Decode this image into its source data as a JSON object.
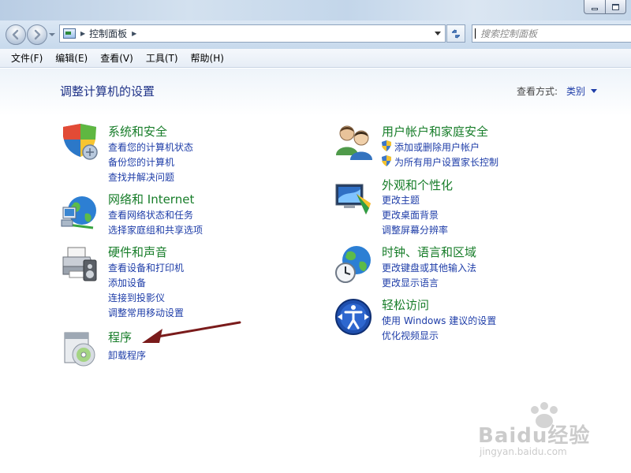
{
  "window": {
    "address": {
      "crumb": "控制面板"
    },
    "search": {
      "placeholder": "搜索控制面板"
    }
  },
  "menu": [
    "文件(F)",
    "编辑(E)",
    "查看(V)",
    "工具(T)",
    "帮助(H)"
  ],
  "page": {
    "title": "调整计算机的设置",
    "view_by_label": "查看方式:",
    "view_by_value": "类别"
  },
  "categories": {
    "system": {
      "title": "系统和安全",
      "links": [
        "查看您的计算机状态",
        "备份您的计算机",
        "查找并解决问题"
      ]
    },
    "network": {
      "title": "网络和 Internet",
      "links": [
        "查看网络状态和任务",
        "选择家庭组和共享选项"
      ]
    },
    "hardware": {
      "title": "硬件和声音",
      "links": [
        "查看设备和打印机",
        "添加设备",
        "连接到投影仪",
        "调整常用移动设置"
      ]
    },
    "programs": {
      "title": "程序",
      "links": [
        "卸载程序"
      ]
    },
    "users": {
      "title": "用户帐户和家庭安全",
      "links": [
        "添加或删除用户帐户",
        "为所有用户设置家长控制"
      ]
    },
    "appearance": {
      "title": "外观和个性化",
      "links": [
        "更改主题",
        "更改桌面背景",
        "调整屏幕分辨率"
      ]
    },
    "clock": {
      "title": "时钟、语言和区域",
      "links": [
        "更改键盘或其他输入法",
        "更改显示语言"
      ]
    },
    "access": {
      "title": "轻松访问",
      "links": [
        "使用 Windows 建议的设置",
        "优化视频显示"
      ]
    }
  },
  "watermark": {
    "brand": "Baidu经验",
    "url": "jingyan.baidu.com"
  },
  "colors": {
    "category_title": "#177d29",
    "link": "#1e3da8",
    "page_title": "#1e3287",
    "annotation_arrow": "#7a1b1b"
  }
}
